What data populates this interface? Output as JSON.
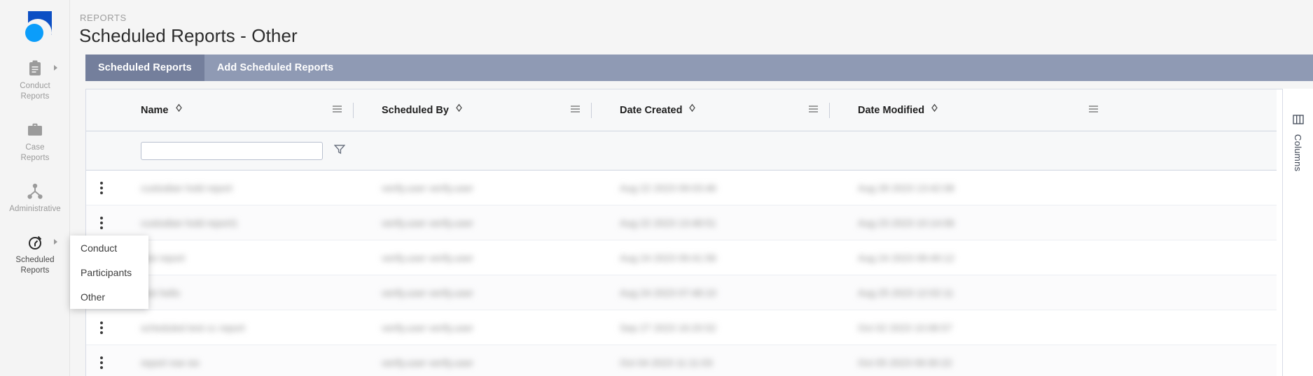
{
  "colors": {
    "logo_square": "#0c4fc4",
    "logo_dot": "#0b9dfa",
    "tabbar_bg": "#8f9ab4",
    "tab_active_bg": "#747f9c",
    "sidebar_bg": "#f4f4f4",
    "page_bg": "#f5f5f5"
  },
  "sidebar": {
    "logo_name": "app-logo",
    "items": [
      {
        "icon": "clipboard-icon",
        "label_line1": "Conduct",
        "label_line2": "Reports",
        "has_caret": true,
        "active": false
      },
      {
        "icon": "briefcase-icon",
        "label_line1": "Case",
        "label_line2": "Reports",
        "has_caret": false,
        "active": false
      },
      {
        "icon": "hierarchy-icon",
        "label_line1": "Administrative",
        "label_line2": "",
        "has_caret": false,
        "active": false
      },
      {
        "icon": "clock-icon",
        "label_line1": "Scheduled",
        "label_line2": "Reports",
        "has_caret": true,
        "active": true
      }
    ]
  },
  "header": {
    "breadcrumb": "REPORTS",
    "title": "Scheduled Reports - Other"
  },
  "tabs": [
    {
      "label": "Scheduled Reports",
      "active": true
    },
    {
      "label": "Add Scheduled Reports",
      "active": false
    }
  ],
  "table": {
    "columns": [
      {
        "label": "Name",
        "sort_icon": "sort-diamond-icon",
        "menu_icon": "column-menu-icon"
      },
      {
        "label": "Scheduled By",
        "sort_icon": "sort-diamond-icon",
        "menu_icon": "column-menu-icon"
      },
      {
        "label": "Date Created",
        "sort_icon": "sort-diamond-icon",
        "menu_icon": "column-menu-icon"
      },
      {
        "label": "Date Modified",
        "sort_icon": "sort-diamond-icon",
        "menu_icon": "column-menu-icon"
      }
    ],
    "filter": {
      "value": "",
      "placeholder": "",
      "funnel_icon": "filter-funnel-icon"
    },
    "rows": [
      {
        "name": "custodian hold report",
        "scheduled_by": "verify.user verify.user",
        "date_created": "Aug 22 2023 09:03:46",
        "date_modified": "Aug 28 2023 13:42:08"
      },
      {
        "name": "custodian hold report1",
        "scheduled_by": "verify.user verify.user",
        "date_created": "Aug 22 2023 13:48:51",
        "date_modified": "Aug 23 2023 10:14:06"
      },
      {
        "name": "test report",
        "scheduled_by": "verify.user verify.user",
        "date_created": "Aug 24 2023 09:41:56",
        "date_modified": "Aug 24 2023 08:49:12"
      },
      {
        "name": "test hello",
        "scheduled_by": "verify.user verify.user",
        "date_created": "Aug 24 2023 07:48:10",
        "date_modified": "Aug 25 2023 12:02:11"
      },
      {
        "name": "scheduled test cc report",
        "scheduled_by": "verify.user verify.user",
        "date_created": "Sep 27 2023 16:20:52",
        "date_modified": "Oct 02 2023 10:08:57"
      },
      {
        "name": "report row six",
        "scheduled_by": "verify.user verify.user",
        "date_created": "Oct 04 2023 11:11:03",
        "date_modified": "Oct 05 2023 09:30:22"
      }
    ],
    "row_menu_icon": "row-kebab-menu-icon"
  },
  "columns_panel": {
    "icon": "columns-grid-icon",
    "label": "Columns"
  },
  "flyout": {
    "items": [
      {
        "label": "Conduct"
      },
      {
        "label": "Participants"
      },
      {
        "label": "Other"
      }
    ]
  }
}
